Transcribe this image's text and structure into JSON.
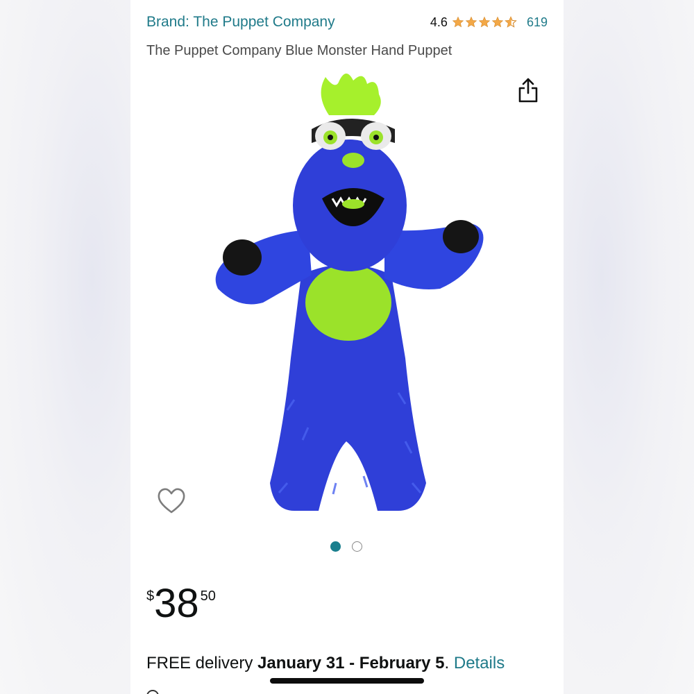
{
  "header": {
    "brand_label": "Brand: The Puppet Company",
    "rating_value": "4.6",
    "rating_stars": 4.6,
    "rating_count": "619"
  },
  "product": {
    "title": "The Puppet Company Blue Monster Hand Puppet",
    "image_icon": "blue-monster-puppet",
    "carousel": {
      "total": 2,
      "active": 1
    }
  },
  "price": {
    "currency": "$",
    "whole": "38",
    "fraction": "50"
  },
  "delivery": {
    "prefix": "FREE delivery ",
    "dates": "January 31 - February 5",
    "separator": ". ",
    "details_link": "Details"
  },
  "colors": {
    "link": "#1f7a89",
    "star": "#f3a847",
    "carousel_active": "#1a7f8e",
    "puppet_blue": "#2a3fd6",
    "puppet_green": "#9be22a"
  }
}
